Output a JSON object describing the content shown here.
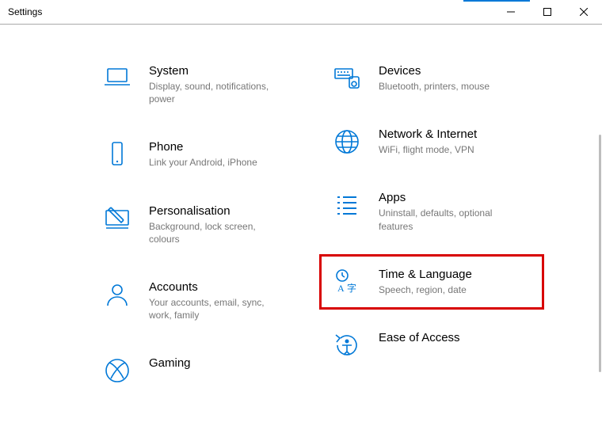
{
  "window": {
    "title": "Settings"
  },
  "left": [
    {
      "title": "System",
      "desc": "Display, sound, notifications, power",
      "icon": "laptop"
    },
    {
      "title": "Phone",
      "desc": "Link your Android, iPhone",
      "icon": "phone"
    },
    {
      "title": "Personalisation",
      "desc": "Background, lock screen, colours",
      "icon": "pen-screen"
    },
    {
      "title": "Accounts",
      "desc": "Your accounts, email, sync, work, family",
      "icon": "person"
    },
    {
      "title": "Gaming",
      "desc": "",
      "icon": "xbox"
    }
  ],
  "right": [
    {
      "title": "Devices",
      "desc": "Bluetooth, printers, mouse",
      "icon": "keyboard-speaker"
    },
    {
      "title": "Network & Internet",
      "desc": "WiFi, flight mode, VPN",
      "icon": "globe"
    },
    {
      "title": "Apps",
      "desc": "Uninstall, defaults, optional features",
      "icon": "list"
    },
    {
      "title": "Time & Language",
      "desc": "Speech, region, date",
      "icon": "time-lang",
      "highlighted": true
    },
    {
      "title": "Ease of Access",
      "desc": "",
      "icon": "ease"
    }
  ]
}
